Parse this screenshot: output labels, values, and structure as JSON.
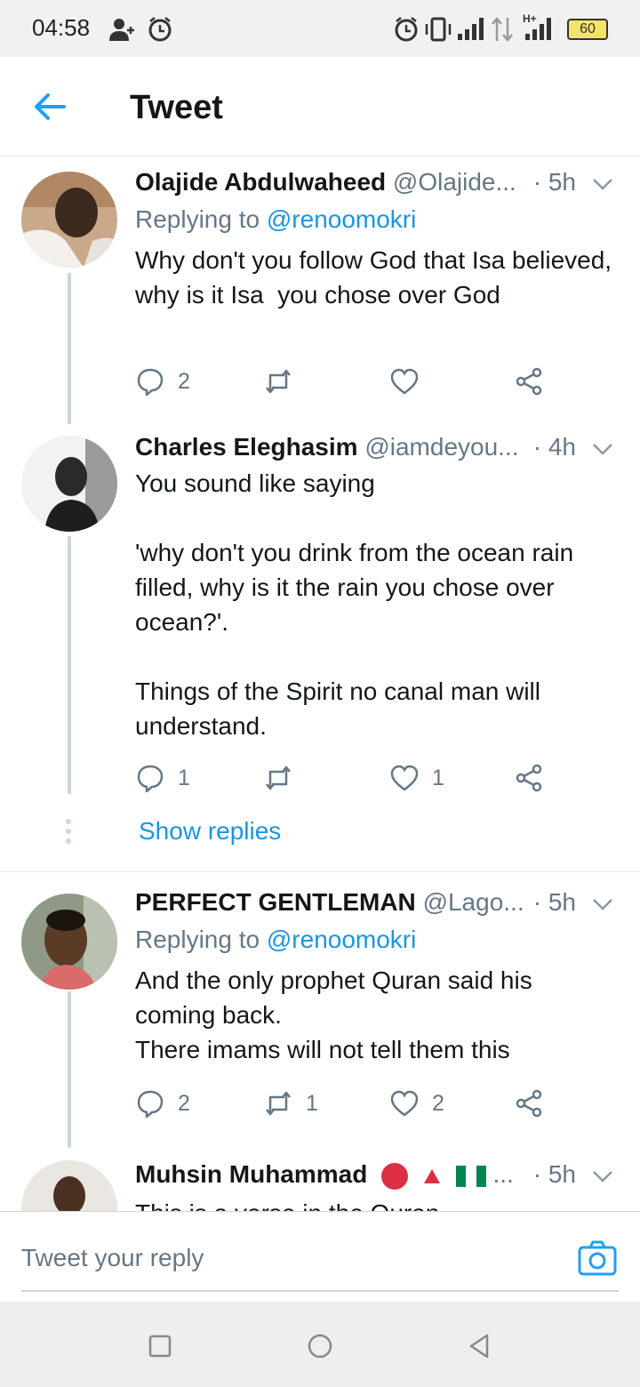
{
  "status_bar": {
    "time": "04:58",
    "battery": "60",
    "icons": [
      "person-add-icon",
      "alarm-icon",
      "vibrate-icon",
      "signal-icon",
      "data-arrows-icon",
      "hplus-signal-icon",
      "battery-icon"
    ]
  },
  "header": {
    "title": "Tweet",
    "back_icon": "arrow-left-icon"
  },
  "colors": {
    "accent": "#1da1f2",
    "link": "#1b95e0",
    "text": "#14171a",
    "muted": "#657786",
    "line": "#ccd6dd"
  },
  "tweets": [
    {
      "name": "Olajide Abdulwaheed",
      "handle": "@Olajide...",
      "time": "· 5h",
      "replying_label": "Replying to",
      "replying_to": "@renoomokri",
      "text": "Why don't you follow God that Isa believed, why is it Isa  you chose over God",
      "replies": "2",
      "retweets": "",
      "likes": ""
    },
    {
      "name": "Charles Eleghasim",
      "handle": "@iamdeyou...",
      "time": "· 4h",
      "text": "You sound like saying\n\n'why don't you drink from the ocean rain filled, why is it the rain you chose over ocean?'.\n\nThings of the Spirit no canal man will understand.",
      "replies": "1",
      "retweets": "",
      "likes": "1",
      "show_replies": "Show replies"
    },
    {
      "name": "PERFECT GENTLEMAN",
      "handle": "@Lago...",
      "time": "· 5h",
      "replying_label": "Replying to",
      "replying_to": "@renoomokri",
      "text": "And the only prophet Quran said his coming back.\nThere imams will not tell them this",
      "replies": "2",
      "retweets": "1",
      "likes": "2"
    },
    {
      "name": "Muhsin Muhammad",
      "emoji_suffix": "...",
      "time": "· 5h",
      "text": "This is a verse in the Quran"
    }
  ],
  "composer": {
    "placeholder": "Tweet your reply",
    "camera_icon": "camera-icon"
  },
  "nav_bar": {
    "icons": [
      "recents-square-icon",
      "home-circle-icon",
      "back-triangle-icon"
    ]
  }
}
